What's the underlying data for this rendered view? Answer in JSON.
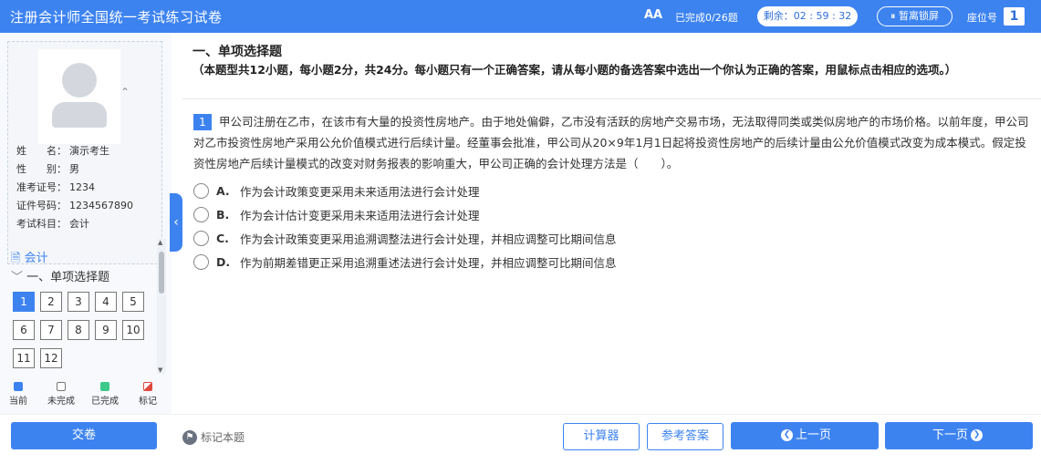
{
  "header": {
    "title": "注册会计师全国统一考试练习试卷",
    "font_size_icon": "AA",
    "progress": "已完成0/26题",
    "timer": "剩余：02 : 59 : 32",
    "pause_label": "暂离锁屏",
    "seat_label": "座位号",
    "seat_number": "1"
  },
  "candidate": {
    "name_label": "姓　　名：",
    "name": "演示考生",
    "gender_label": "性　　别：",
    "gender": "男",
    "ticket_label": "准考证号：",
    "ticket": "1234",
    "id_label": "证件号码：",
    "id": "1234567890",
    "subject_label": "考试科目：",
    "subject": "会计"
  },
  "nav": {
    "subject": "会计",
    "section": "一、单项选择题",
    "questions": [
      "1",
      "2",
      "3",
      "4",
      "5",
      "6",
      "7",
      "8",
      "9",
      "10",
      "11",
      "12"
    ],
    "current": "1",
    "legend": [
      "当前",
      "未完成",
      "已完成",
      "标记"
    ]
  },
  "section": {
    "title": "一、单项选择题",
    "description": "（本题型共12小题，每小题2分，共24分。每小题只有一个正确答案，请从每小题的备选答案中选出一个你认为正确的答案，用鼠标点击相应的选项。）"
  },
  "question": {
    "number": "1",
    "stem": "甲公司注册在乙市，在该市有大量的投资性房地产。由于地处偏僻，乙市没有活跃的房地产交易市场，无法取得同类或类似房地产的市场价格。以前年度，甲公司对乙市投资性房地产采用公允价值模式进行后续计量。经董事会批准，甲公司从20×9年1月1日起将投资性房地产的后续计量由公允价值模式改变为成本模式。假定投资性房地产后续计量模式的改变对财务报表的影响重大，甲公司正确的会计处理方法是（　　）。",
    "options": [
      {
        "letter": "A.",
        "text": "作为会计政策变更采用未来适用法进行会计处理"
      },
      {
        "letter": "B.",
        "text": "作为会计估计变更采用未来适用法进行会计处理"
      },
      {
        "letter": "C.",
        "text": "作为会计政策变更采用追溯调整法进行会计处理，并相应调整可比期间信息"
      },
      {
        "letter": "D.",
        "text": "作为前期差错更正采用追溯重述法进行会计处理，并相应调整可比期间信息"
      }
    ]
  },
  "footer": {
    "submit": "交卷",
    "flag": "标记本题",
    "calculator": "计算器",
    "answer": "参考答案",
    "prev": "上一页",
    "next": "下一页"
  },
  "colors": {
    "accent": "#3d83f0",
    "done": "#3cc98a",
    "marked": "#e0483e"
  }
}
